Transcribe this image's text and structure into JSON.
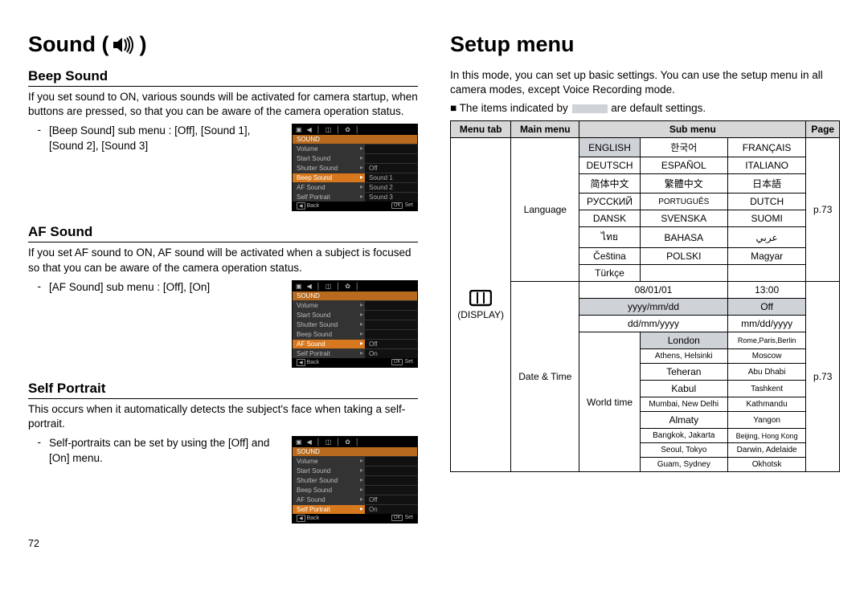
{
  "pageNumber": "72",
  "left": {
    "title": "Sound (",
    "titleEnd": ")",
    "sections": [
      {
        "heading": "Beep Sound",
        "body": "If you set sound to ON, various sounds will be activated for camera startup, when buttons are pressed, so that you can be aware of the camera operation status.",
        "bullet": "[Beep Sound] sub menu : [Off], [Sound 1], [Sound 2], [Sound 3]",
        "lcd": {
          "header": "SOUND",
          "rows": [
            {
              "label": "Volume",
              "value": "",
              "hl": false
            },
            {
              "label": "Start Sound",
              "value": "",
              "hl": false
            },
            {
              "label": "Shutter Sound",
              "value": "Off",
              "hl": false
            },
            {
              "label": "Beep Sound",
              "value": "Sound 1",
              "hl": true
            },
            {
              "label": "AF Sound",
              "value": "Sound 2",
              "hl": false
            },
            {
              "label": "Self Portrait",
              "value": "Sound 3",
              "hl": false
            }
          ],
          "footerBack": "Back",
          "footerSet": "Set",
          "footerOk": "OK"
        }
      },
      {
        "heading": "AF Sound",
        "body": "If you set AF sound to ON, AF sound will be activated when a subject is focused so that you can be aware of the camera operation status.",
        "bullet": "[AF Sound] sub menu : [Off], [On]",
        "lcd": {
          "header": "SOUND",
          "rows": [
            {
              "label": "Volume",
              "value": "",
              "hl": false
            },
            {
              "label": "Start Sound",
              "value": "",
              "hl": false
            },
            {
              "label": "Shutter Sound",
              "value": "",
              "hl": false
            },
            {
              "label": "Beep Sound",
              "value": "",
              "hl": false
            },
            {
              "label": "AF Sound",
              "value": "Off",
              "hl": true
            },
            {
              "label": "Self Portrait",
              "value": "On",
              "hl": false
            }
          ],
          "footerBack": "Back",
          "footerSet": "Set",
          "footerOk": "OK"
        }
      },
      {
        "heading": "Self Portrait",
        "body": "This occurs when it automatically detects the subject's face when taking a self-portrait.",
        "bullet": "Self-portraits can be set by using the [Off] and [On] menu.",
        "lcd": {
          "header": "SOUND",
          "rows": [
            {
              "label": "Volume",
              "value": "",
              "hl": false
            },
            {
              "label": "Start Sound",
              "value": "",
              "hl": false
            },
            {
              "label": "Shutter Sound",
              "value": "",
              "hl": false
            },
            {
              "label": "Beep Sound",
              "value": "",
              "hl": false
            },
            {
              "label": "AF Sound",
              "value": "Off",
              "hl": false
            },
            {
              "label": "Self Portrait",
              "value": "On",
              "hl": true
            }
          ],
          "footerBack": "Back",
          "footerSet": "Set",
          "footerOk": "OK"
        }
      }
    ]
  },
  "right": {
    "title": "Setup menu",
    "intro": "In this mode, you can set up basic settings. You can use the setup menu in all camera modes, except Voice Recording mode.",
    "noteBefore": "The items indicated by",
    "noteAfter": "are default settings.",
    "tableHeader": {
      "menuTab": "Menu tab",
      "mainMenu": "Main menu",
      "subMenu": "Sub menu",
      "page": "Page"
    },
    "menuTabLabel": "(DISPLAY)",
    "language": {
      "label": "Language",
      "page": "p.73",
      "rows": [
        [
          "ENGLISH",
          "한국어",
          "FRANÇAIS"
        ],
        [
          "DEUTSCH",
          "ESPAÑOL",
          "ITALIANO"
        ],
        [
          "简体中文",
          "繁體中文",
          "日本語"
        ],
        [
          "РУССКИЙ",
          "PORTUGUÊS",
          "DUTCH"
        ],
        [
          "DANSK",
          "SVENSKA",
          "SUOMI"
        ],
        [
          "ไทย",
          "BAHASA",
          "عربي"
        ],
        [
          "Čeština",
          "POLSKI",
          "Magyar"
        ],
        [
          "Türkçe",
          "",
          ""
        ]
      ]
    },
    "dateTime": {
      "label": "Date & Time",
      "page": "p.73",
      "dateRows": [
        {
          "c1": "08/01/01",
          "c2": "13:00",
          "def": false
        },
        {
          "c1": "yyyy/mm/dd",
          "c2": "Off",
          "def": true
        },
        {
          "c1": "dd/mm/yyyy",
          "c2": "mm/dd/yyyy",
          "def": false
        }
      ],
      "worldTimeLabel": "World time",
      "cities": [
        [
          "London",
          "Rome,Paris,Berlin"
        ],
        [
          "Athens, Helsinki",
          "Moscow"
        ],
        [
          "Teheran",
          "Abu Dhabi"
        ],
        [
          "Kabul",
          "Tashkent"
        ],
        [
          "Mumbai, New Delhi",
          "Kathmandu"
        ],
        [
          "Almaty",
          "Yangon"
        ],
        [
          "Bangkok, Jakarta",
          "Beijing, Hong Kong"
        ],
        [
          "Seoul, Tokyo",
          "Darwin, Adelaide"
        ],
        [
          "Guam, Sydney",
          "Okhotsk"
        ]
      ]
    }
  }
}
